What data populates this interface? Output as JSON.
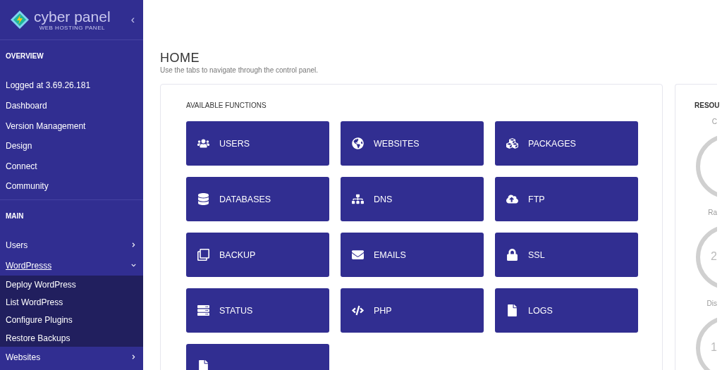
{
  "brand": {
    "name": "cyber panel",
    "tagline": "WEB HOSTING PANEL",
    "collapse": "‹"
  },
  "sidebar": {
    "sections": [
      {
        "title": "OVERVIEW",
        "items": [
          {
            "label": "Logged at 3.69.26.181",
            "has_children": false,
            "expanded": false
          },
          {
            "label": "Dashboard",
            "has_children": false,
            "expanded": false
          },
          {
            "label": "Version Management",
            "has_children": false,
            "expanded": false
          },
          {
            "label": "Design",
            "has_children": false,
            "expanded": false
          },
          {
            "label": "Connect",
            "has_children": false,
            "expanded": false
          },
          {
            "label": "Community",
            "has_children": false,
            "expanded": false
          }
        ]
      },
      {
        "title": "MAIN",
        "items": [
          {
            "label": "Users",
            "has_children": true,
            "expanded": false
          },
          {
            "label": "WordPresss",
            "has_children": true,
            "expanded": true,
            "children": [
              {
                "label": "Deploy WordPress"
              },
              {
                "label": "List WordPress"
              },
              {
                "label": "Configure Plugins"
              },
              {
                "label": "Restore Backups"
              }
            ]
          },
          {
            "label": "Websites",
            "has_children": true,
            "expanded": false
          }
        ]
      }
    ]
  },
  "page": {
    "title": "HOME",
    "subtitle": "Use the tabs to navigate through the control panel."
  },
  "functions": {
    "title": "AVAILABLE FUNCTIONS",
    "items": [
      {
        "kind": "users",
        "label": "USERS"
      },
      {
        "kind": "globe",
        "label": "WEBSITES"
      },
      {
        "kind": "cubes",
        "label": "PACKAGES"
      },
      {
        "kind": "database",
        "label": "DATABASES"
      },
      {
        "kind": "sitemap",
        "label": "DNS"
      },
      {
        "kind": "cloud",
        "label": "FTP"
      },
      {
        "kind": "copy",
        "label": "BACKUP"
      },
      {
        "kind": "envelope",
        "label": "EMAILS"
      },
      {
        "kind": "lock",
        "label": "SSL"
      },
      {
        "kind": "server",
        "label": "STATUS"
      },
      {
        "kind": "code",
        "label": "PHP"
      },
      {
        "kind": "file",
        "label": "LOGS"
      },
      {
        "kind": "file"
      }
    ]
  },
  "resources": {
    "title": "RESOU",
    "gauges": [
      {
        "label": "C"
      },
      {
        "label": "Ra",
        "value": "2"
      },
      {
        "label": "Dis",
        "value": "1"
      }
    ]
  }
}
